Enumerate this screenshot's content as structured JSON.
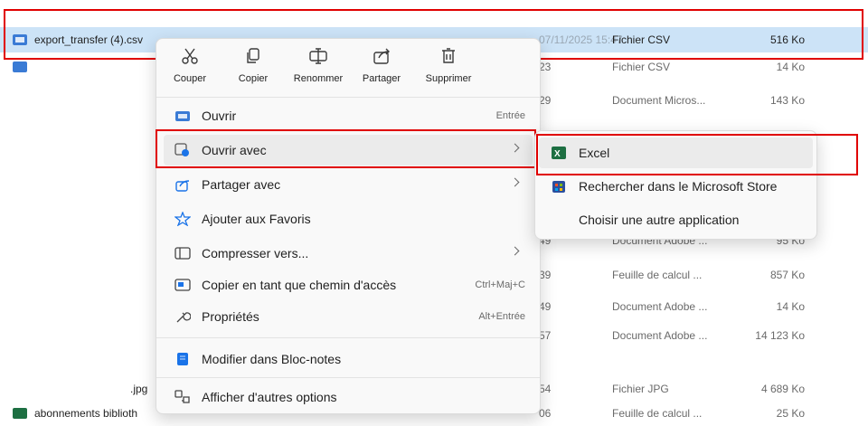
{
  "colors": {
    "highlight": "#e00000",
    "selection": "#cce3f7",
    "excel": "#1d6f42",
    "store": "#2b4f9e"
  },
  "rows": [
    {
      "name": "export_transfer (4).csv",
      "date": "07/11/2025 15:47",
      "type": "Fichier CSV",
      "size": "516 Ko",
      "selected": true
    },
    {
      "name": "",
      "date": "23",
      "type": "Fichier CSV",
      "size": "14 Ko"
    },
    {
      "name": "",
      "date": "29",
      "type": "Document Micros...",
      "size": "143 Ko"
    },
    {
      "name": "",
      "date": "49",
      "type": "Document Adobe ...",
      "size": "95 Ko"
    },
    {
      "name": "",
      "date": "39",
      "type": "Feuille de calcul ...",
      "size": "857 Ko"
    },
    {
      "name": "",
      "date": "49",
      "type": "Document Adobe ...",
      "size": "14 Ko"
    },
    {
      "name": "",
      "date": "57",
      "type": "Document Adobe ...",
      "size": "14 123 Ko"
    },
    {
      "name": ".jpg",
      "date": "54",
      "type": "Fichier JPG",
      "size": "4 689 Ko"
    },
    {
      "name": "abonnements biblioth",
      "date": "06",
      "type": "Feuille de calcul ...",
      "size": "25 Ko"
    }
  ],
  "quick_actions": [
    {
      "label": "Couper",
      "icon": "scissors-icon"
    },
    {
      "label": "Copier",
      "icon": "copy-icon"
    },
    {
      "label": "Renommer",
      "icon": "rename-icon"
    },
    {
      "label": "Partager",
      "icon": "share-icon"
    },
    {
      "label": "Supprimer",
      "icon": "trash-icon"
    }
  ],
  "menu": {
    "open": {
      "label": "Ouvrir",
      "shortcut": "Entrée",
      "icon": "open-file-icon"
    },
    "open_with": {
      "label": "Ouvrir avec",
      "icon": "open-with-icon"
    },
    "share_with": {
      "label": "Partager avec",
      "icon": "share-icon"
    },
    "favorites": {
      "label": "Ajouter aux Favoris",
      "icon": "star-icon"
    },
    "compress": {
      "label": "Compresser vers...",
      "icon": "archive-icon"
    },
    "copy_path": {
      "label": "Copier en tant que chemin d'accès",
      "shortcut": "Ctrl+Maj+C",
      "icon": "path-icon"
    },
    "properties": {
      "label": "Propriétés",
      "shortcut": "Alt+Entrée",
      "icon": "wrench-icon"
    },
    "notepad": {
      "label": "Modifier dans Bloc-notes",
      "icon": "notepad-icon"
    },
    "more": {
      "label": "Afficher d'autres options",
      "icon": "more-options-icon"
    }
  },
  "submenu": {
    "excel": {
      "label": "Excel",
      "icon": "excel-icon"
    },
    "store": {
      "label": "Rechercher dans le Microsoft Store",
      "icon": "store-icon"
    },
    "other": {
      "label": "Choisir une autre application"
    }
  }
}
